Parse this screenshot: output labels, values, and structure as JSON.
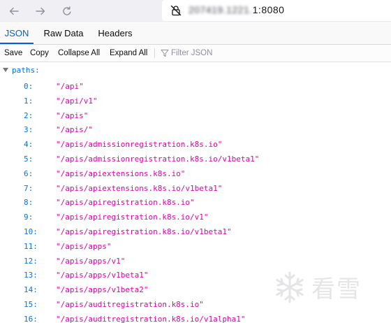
{
  "browser": {
    "url_visible": "1:8080",
    "url_obscured": "207419.1221.",
    "icons": {
      "back": "arrow-left-icon",
      "forward": "arrow-right-icon",
      "reload": "reload-icon",
      "insecure": "insecure-lock-icon"
    }
  },
  "tabs": [
    {
      "label": "JSON",
      "active": true
    },
    {
      "label": "Raw Data",
      "active": false
    },
    {
      "label": "Headers",
      "active": false
    }
  ],
  "actions": {
    "save": "Save",
    "copy": "Copy",
    "collapse_all": "Collapse All",
    "expand_all": "Expand All",
    "filter_placeholder": "Filter JSON"
  },
  "tree": {
    "root_key": "paths:",
    "items": [
      {
        "index": "0:",
        "value": "\"/api\""
      },
      {
        "index": "1:",
        "value": "\"/api/v1\""
      },
      {
        "index": "2:",
        "value": "\"/apis\""
      },
      {
        "index": "3:",
        "value": "\"/apis/\""
      },
      {
        "index": "4:",
        "value": "\"/apis/admissionregistration.k8s.io\""
      },
      {
        "index": "5:",
        "value": "\"/apis/admissionregistration.k8s.io/v1beta1\""
      },
      {
        "index": "6:",
        "value": "\"/apis/apiextensions.k8s.io\""
      },
      {
        "index": "7:",
        "value": "\"/apis/apiextensions.k8s.io/v1beta1\""
      },
      {
        "index": "8:",
        "value": "\"/apis/apiregistration.k8s.io\""
      },
      {
        "index": "9:",
        "value": "\"/apis/apiregistration.k8s.io/v1\""
      },
      {
        "index": "10:",
        "value": "\"/apis/apiregistration.k8s.io/v1beta1\""
      },
      {
        "index": "11:",
        "value": "\"/apis/apps\""
      },
      {
        "index": "12:",
        "value": "\"/apis/apps/v1\""
      },
      {
        "index": "13:",
        "value": "\"/apis/apps/v1beta1\""
      },
      {
        "index": "14:",
        "value": "\"/apis/apps/v1beta2\""
      },
      {
        "index": "15:",
        "value": "\"/apis/auditregistration.k8s.io\""
      },
      {
        "index": "16:",
        "value": "\"/apis/auditregistration.k8s.io/v1alpha1\""
      }
    ]
  },
  "watermark": {
    "text": "看雪",
    "icon": "snowflake-icon"
  }
}
